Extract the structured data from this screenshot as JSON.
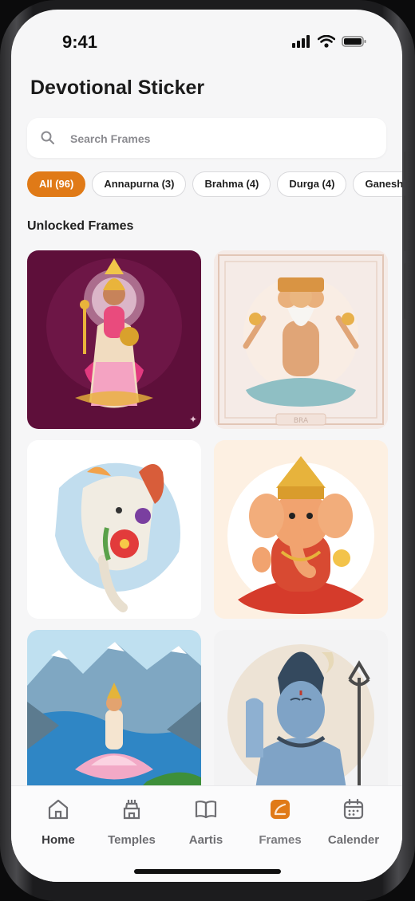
{
  "status_bar": {
    "time": "9:41"
  },
  "header": {
    "title": "Devotional Sticker"
  },
  "search": {
    "placeholder": "Search Frames",
    "value": ""
  },
  "filters": [
    {
      "label": "All (96)",
      "active": true
    },
    {
      "label": "Annapurna (3)",
      "active": false
    },
    {
      "label": "Brahma (4)",
      "active": false
    },
    {
      "label": "Durga (4)",
      "active": false
    },
    {
      "label": "Ganesh",
      "active": false
    }
  ],
  "section": {
    "title": "Unlocked Frames"
  },
  "frames": [
    {
      "deity": "annapurna",
      "image_text": ""
    },
    {
      "deity": "brahma",
      "image_text": "BRA"
    },
    {
      "deity": "ganesh-artistic",
      "image_text": ""
    },
    {
      "deity": "ganesh-seated",
      "image_text": ""
    },
    {
      "deity": "lakshmi-river",
      "image_text": ""
    },
    {
      "deity": "shiva",
      "image_text": ""
    }
  ],
  "bottom_nav": [
    {
      "label": "Home",
      "icon": "home-icon"
    },
    {
      "label": "Temples",
      "icon": "temple-icon"
    },
    {
      "label": "Aartis",
      "icon": "book-icon"
    },
    {
      "label": "Frames",
      "icon": "frame-icon",
      "active": true
    },
    {
      "label": "Calender",
      "icon": "calendar-icon"
    }
  ],
  "colors": {
    "accent": "#e07a17",
    "background": "#f6f6f7"
  }
}
